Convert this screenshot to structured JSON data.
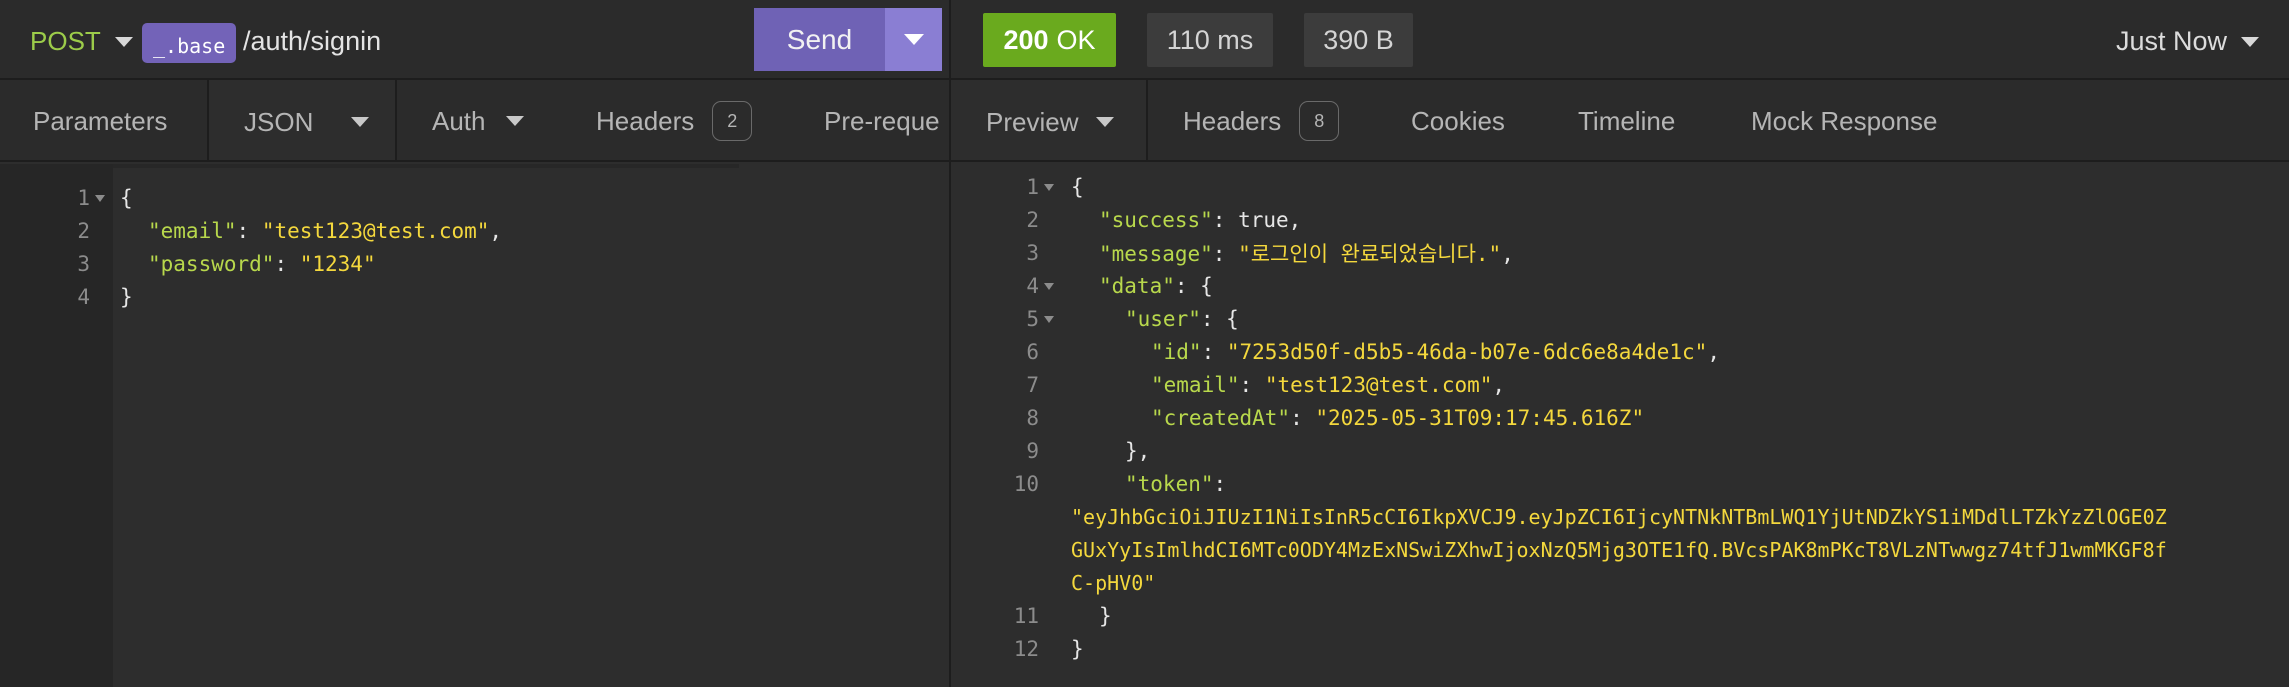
{
  "request": {
    "method": "POST",
    "env_chip": "_.base",
    "path": "/auth/signin",
    "send_label": "Send",
    "tabs": [
      {
        "label": "Parameters"
      },
      {
        "label": "JSON"
      },
      {
        "label": "Auth"
      },
      {
        "label": "Headers",
        "count": "2"
      },
      {
        "label": "Pre-reque"
      }
    ],
    "body_lines": [
      {
        "num": "1",
        "fold": true
      },
      {
        "num": "2"
      },
      {
        "num": "3"
      },
      {
        "num": "4"
      }
    ],
    "body": {
      "email_key": "\"email\"",
      "email_value": "\"test123@test.com\"",
      "password_key": "\"password\"",
      "password_value": "\"1234\""
    }
  },
  "response": {
    "status_code": "200",
    "status_text": "OK",
    "time": "110 ms",
    "size": "390 B",
    "timestamp": "Just Now",
    "tabs": [
      {
        "label": "Preview"
      },
      {
        "label": "Headers",
        "count": "8"
      },
      {
        "label": "Cookies"
      },
      {
        "label": "Timeline"
      },
      {
        "label": "Mock Response"
      }
    ],
    "line_numbers": [
      "1",
      "2",
      "3",
      "4",
      "5",
      "6",
      "7",
      "8",
      "9",
      "10",
      "11",
      "12"
    ],
    "body": {
      "success_key": "\"success\"",
      "success_value": "true",
      "message_key": "\"message\"",
      "message_value": "\"로그인이 완료되었습니다.\"",
      "data_key": "\"data\"",
      "user_key": "\"user\"",
      "id_key": "\"id\"",
      "id_value": "\"7253d50f-d5b5-46da-b07e-6dc6e8a4de1c\"",
      "email_key": "\"email\"",
      "email_value": "\"test123@test.com\"",
      "created_key": "\"createdAt\"",
      "created_value": "\"2025-05-31T09:17:45.616Z\"",
      "token_key": "\"token\"",
      "token_line1": "\"eyJhbGciOiJIUzI1NiIsInR5cCI6IkpXVCJ9.eyJpZCI6IjcyNTNkNTBmLWQ1YjUtNDZkYS1iMDdlLTZkYzZlOGE0Z",
      "token_line2": "GUxYyIsImlhdCI6MTc0ODY4MzExNSwiZXhwIjoxNzQ5Mjg3OTE1fQ.BVcsPAK8mPKcT8VLzNTwwgz74tfJ1wmMKGF8f",
      "token_line3": "C-pHV0\""
    }
  }
}
